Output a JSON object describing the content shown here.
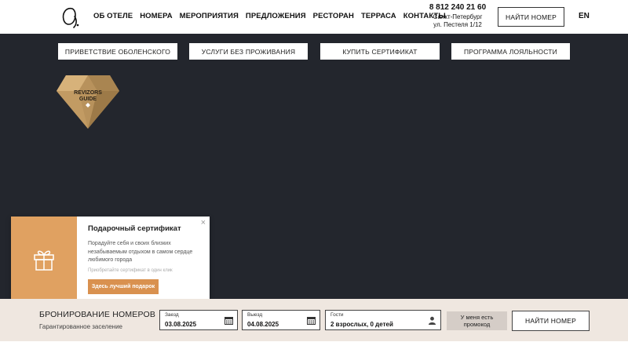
{
  "header": {
    "logo_icon": "signature-logo-icon",
    "nav": [
      "ОБ ОТЕЛЕ",
      "НОМЕРА",
      "МЕРОПРИЯТИЯ",
      "ПРЕДЛОЖЕНИЯ",
      "РЕСТОРАН",
      "ТЕРРАСА",
      "КОНТАКТЫ"
    ],
    "phone": "8 812 240 21 60",
    "city": "Санкт-Петербург",
    "street": "ул. Пестеля 1/12",
    "find_room": "НАЙТИ НОМЕР",
    "lang": "EN"
  },
  "subnav": [
    "ПРИВЕТСТВИЕ ОБОЛЕНСКОГО",
    "УСЛУГИ БЕЗ ПРОЖИВАНИЯ",
    "КУПИТЬ СЕРТИФИКАТ",
    "ПРОГРАММА ЛОЯЛЬНОСТИ"
  ],
  "badge": {
    "line1": "REVIZORS",
    "line2": "GUIDE",
    "color": "#c9a36a"
  },
  "popup": {
    "title": "Подарочный сертификат",
    "text": "Порадуйте себя и своих близких незабываемым отдыхом в самом сердце любимого города",
    "note": "Приобретайте сертификат в один клик",
    "button": "Здесь лучший подарок",
    "close": "×",
    "accent": "#e0a161",
    "icon": "gift-icon"
  },
  "booking": {
    "title": "БРОНИРОВАНИЕ НОМЕРОВ",
    "subtitle": "Гарантированное заселение",
    "checkin_label": "Заезд",
    "checkin_value": "03.08.2025",
    "checkout_label": "Выезд",
    "checkout_value": "04.08.2025",
    "guests_label": "Гости",
    "guests_value": "2 взрослых, 0 детей",
    "promo_line1": "У меня есть",
    "promo_line2": "промокод",
    "find_room": "НАЙТИ НОМЕР"
  }
}
